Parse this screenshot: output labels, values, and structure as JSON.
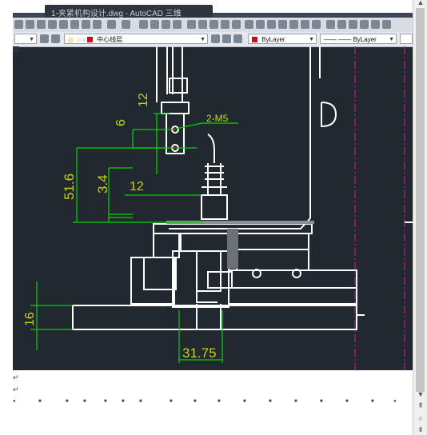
{
  "window": {
    "title": "1-夹紧机构设计.dwg - AutoCAD 三维"
  },
  "cad": {
    "layer_dropdown": {
      "value": "中心线层",
      "color": "#e0001b"
    },
    "color_dropdown": {
      "value": "ByLayer",
      "color": "#e0001b"
    },
    "linetype_dropdown": {
      "value": "ByLayer"
    },
    "dimensions": {
      "d12_top": "12",
      "d6": "6",
      "m5": "2-M5",
      "d51_6": "51.6",
      "d3_4": "3.4",
      "d12_mid": "12",
      "d16": "16",
      "d31_75": "31.75"
    },
    "colors": {
      "background": "#212830",
      "drawing": "#ffffff",
      "dimension": "#c8d400",
      "dim_line": "#00d400",
      "centerline": "#b0127a"
    }
  },
  "doc": {
    "para_mark": "↵"
  }
}
